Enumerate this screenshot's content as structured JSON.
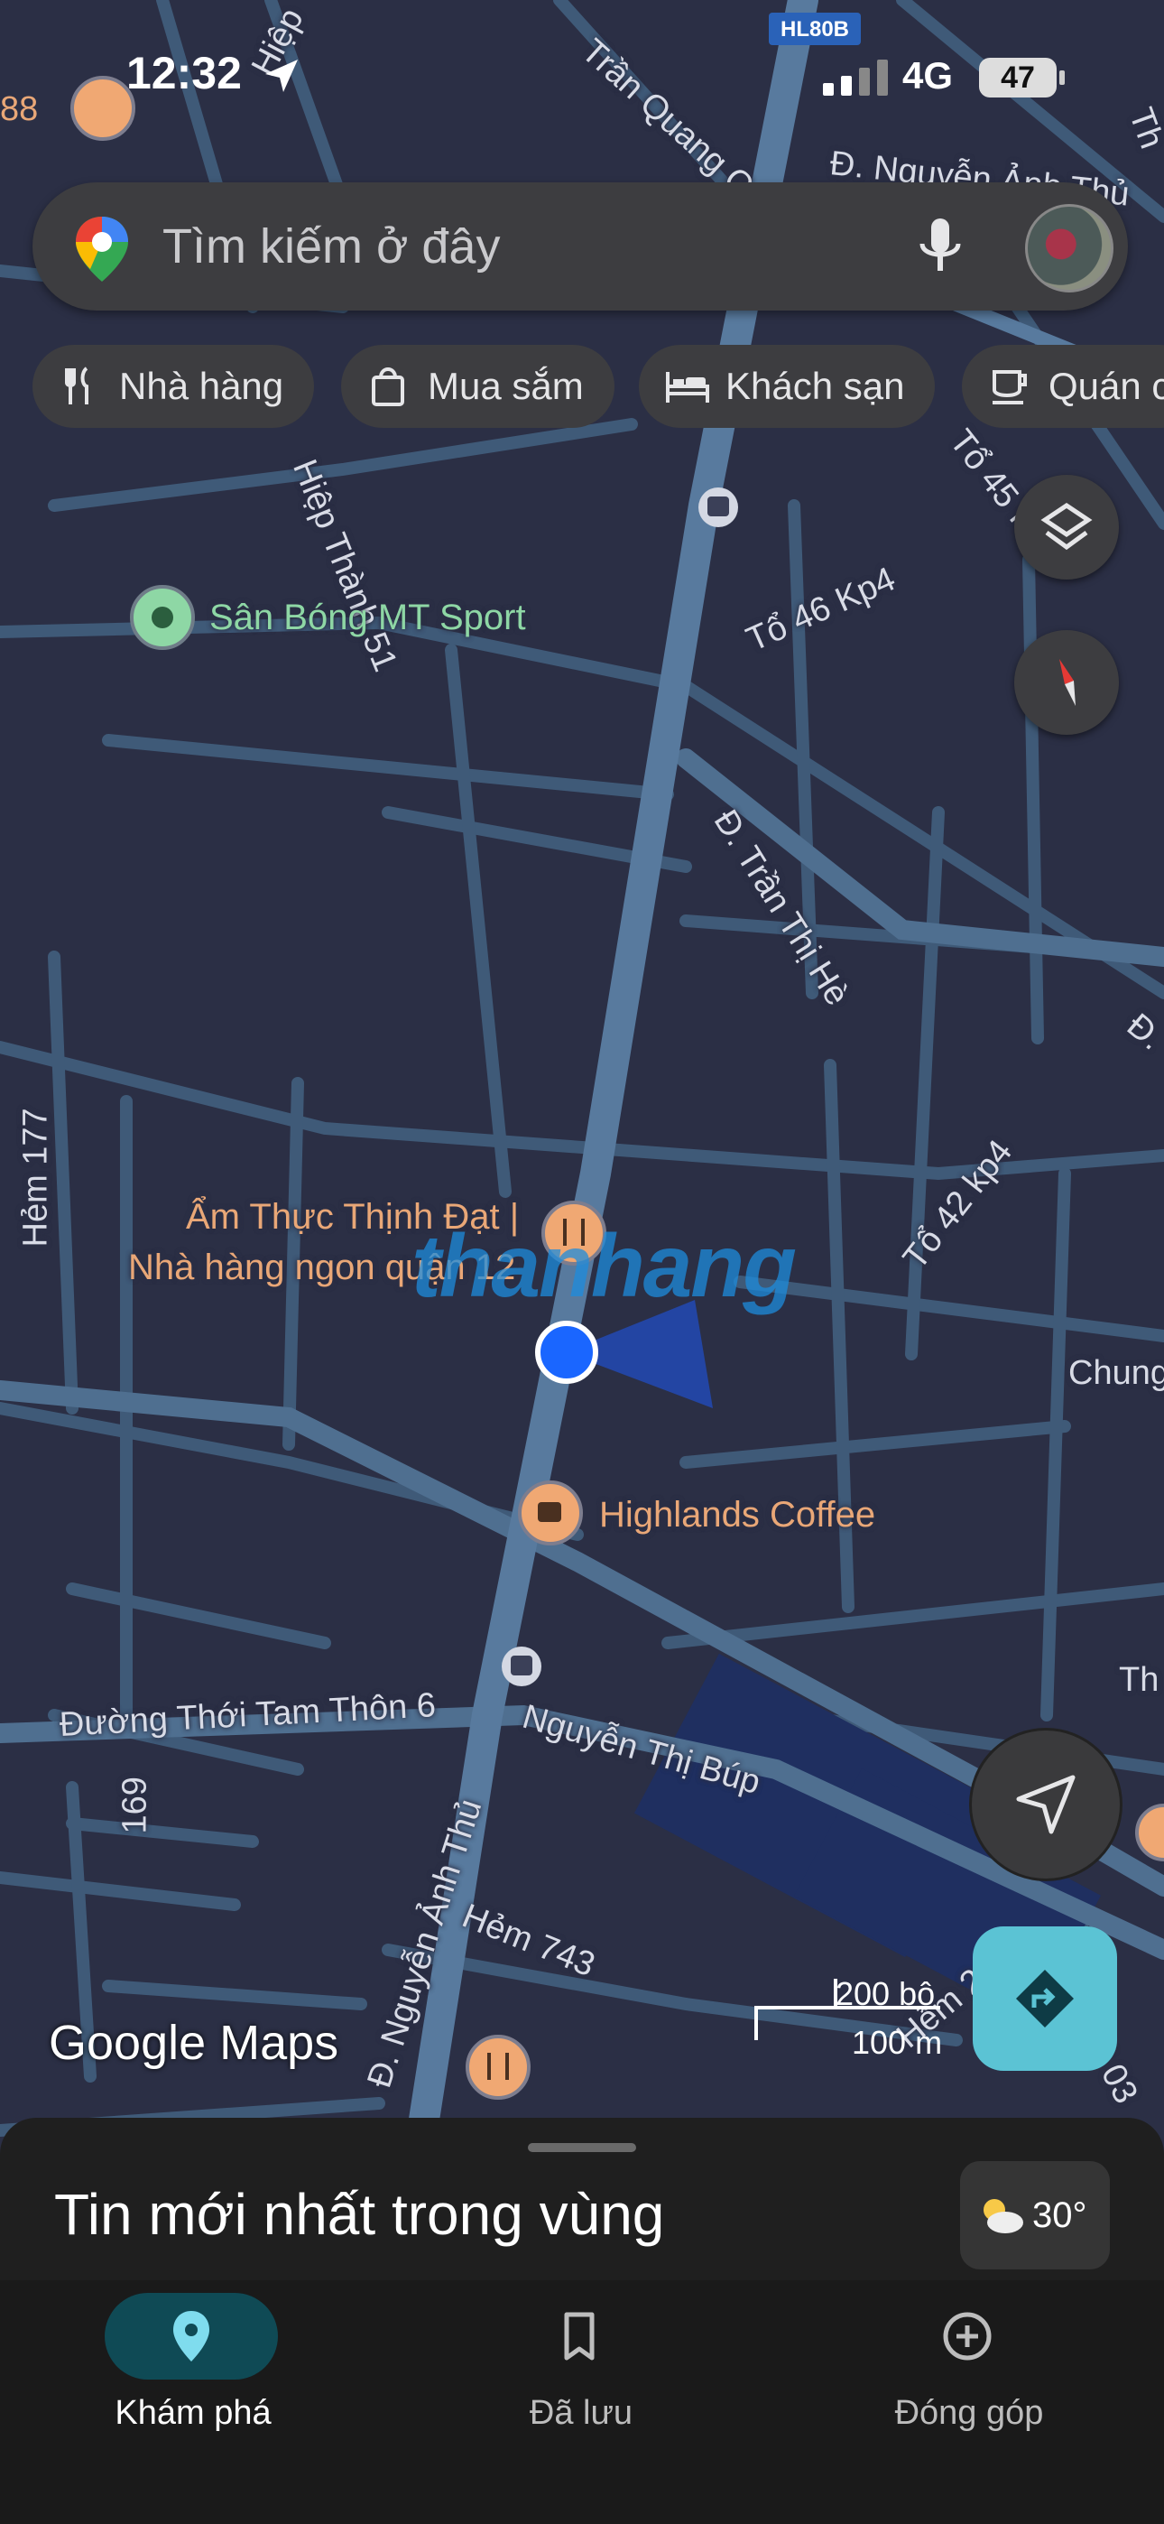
{
  "status_bar": {
    "time": "12:32",
    "network": "4G",
    "battery": "47"
  },
  "search": {
    "placeholder": "Tìm kiếm ở đây"
  },
  "chips": [
    {
      "label": "Nhà hàng",
      "icon": "fork-knife-icon"
    },
    {
      "label": "Mua sắm",
      "icon": "shopping-bag-icon"
    },
    {
      "label": "Khách sạn",
      "icon": "bed-icon"
    },
    {
      "label": "Quán c",
      "icon": "cup-icon"
    }
  ],
  "map": {
    "route_badge": "HL80B",
    "edge_label": "88",
    "streets": {
      "tran_quang_co": "Trần Quang Cơ",
      "nguyen_anh_thu_top": "Đ. Nguyễn Ảnh Thủ",
      "hiep_thanh_51": "Hiệp Thành 51",
      "hiep_top": "Hiệp",
      "to_45": "Tổ 45 KP",
      "to_46": "Tổ 46 Kp4",
      "tran_thi_he": "Đ. Trần Thị Hè",
      "to_42": "Tổ 42 kp4",
      "hem_177": "Hẻm 177",
      "thoi_tam_thon_6": "Đường Thới Tam Thôn 6",
      "nguyen_thi_bup": "Nguyễn Thị Búp",
      "n169": "169",
      "nguyen_anh_thu_bottom": "Đ. Nguyễn Ảnh Thủ",
      "hem_743": "Hẻm 743",
      "chung": "Chung",
      "th_right": "Th",
      "hem_bottom": "Hẻm 2",
      "i03": "I 03",
      "d_right": "Đ.",
      "thi_right": "Th"
    },
    "pois": {
      "sport": "Sân Bóng MT Sport",
      "restaurant_line1": "Ẩm Thực Thịnh Đạt |",
      "restaurant_line2": "Nhà hàng ngon quận 12",
      "coffee": "Highlands Coffee"
    },
    "watermark": "thanhang",
    "logo": "Google Maps",
    "scale_imperial": "200 bộ",
    "scale_metric": "100 m"
  },
  "sheet": {
    "title": "Tin mới nhất trong vùng",
    "temperature": "30°"
  },
  "bottom_nav": [
    {
      "label": "Khám phá",
      "active": true
    },
    {
      "label": "Đã lưu",
      "active": false
    },
    {
      "label": "Đóng góp",
      "active": false
    }
  ],
  "colors": {
    "map_bg": "#2b2f45",
    "road": "#4a6a88",
    "major_road": "#5b7fa3",
    "accent": "#5bc3d4",
    "poi_orange": "#e9a777",
    "poi_green": "#8ed7a5",
    "location_dot": "#1a66ff"
  }
}
